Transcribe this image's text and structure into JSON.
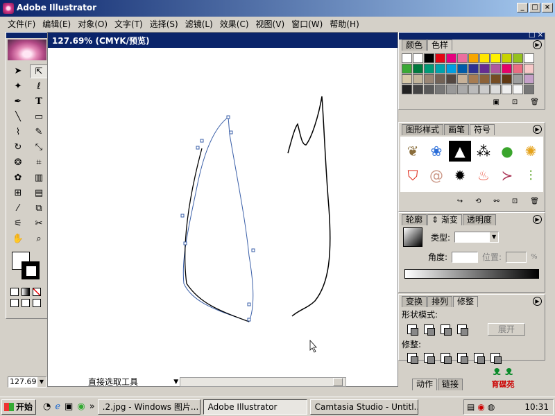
{
  "app": {
    "title": "Adobe Illustrator"
  },
  "menu": [
    "文件(F)",
    "编辑(E)",
    "对象(O)",
    "文字(T)",
    "选择(S)",
    "滤镜(L)",
    "效果(C)",
    "视图(V)",
    "窗口(W)",
    "帮助(H)"
  ],
  "document": {
    "title": "127.69% (CMYK/预览)"
  },
  "status": {
    "zoom": "127.69",
    "tool_name": "直接选取工具"
  },
  "panels": {
    "swatches": {
      "tabs": [
        "颜色",
        "色样"
      ]
    },
    "symbols": {
      "tabs": [
        "图形样式",
        "画笔",
        "符号"
      ]
    },
    "gradient": {
      "tabs": [
        "轮廓",
        "渐变",
        "透明度"
      ],
      "type_label": "类型:",
      "angle_label": "角度:",
      "position_label": "位置:",
      "percent": "%"
    },
    "pathfinder": {
      "tabs": [
        "变换",
        "排列",
        "修整"
      ],
      "shape_modes_label": "形状模式:",
      "expand_label": "展开",
      "pathfinders_label": "修整:"
    },
    "actions": {
      "tabs": [
        "动作",
        "链接"
      ]
    }
  },
  "watermark": {
    "text": "育碟苑"
  },
  "taskbar": {
    "start_label": "开始",
    "tasks": [
      ".2.jpg - Windows 图片...",
      "Adobe Illustrator",
      "Camtasia Studio - Untitl..."
    ],
    "clock": "10:31"
  },
  "colors": {
    "title_gradient_start": "#0a246a",
    "title_gradient_end": "#a6caf0",
    "path_selected": "#3a5fa8",
    "path_stroke": "#000000"
  },
  "icons": [
    "selection-icon",
    "direct-selection-icon",
    "magic-wand-icon",
    "lasso-icon",
    "pen-icon",
    "type-icon",
    "line-icon",
    "rectangle-icon",
    "paintbrush-icon",
    "pencil-icon",
    "rotate-icon",
    "scale-icon",
    "warp-icon",
    "free-transform-icon",
    "symbol-sprayer-icon",
    "graph-icon",
    "mesh-icon",
    "gradient-icon",
    "eyedropper-icon",
    "blend-icon",
    "slice-icon",
    "scissors-icon",
    "hand-icon",
    "zoom-icon"
  ]
}
